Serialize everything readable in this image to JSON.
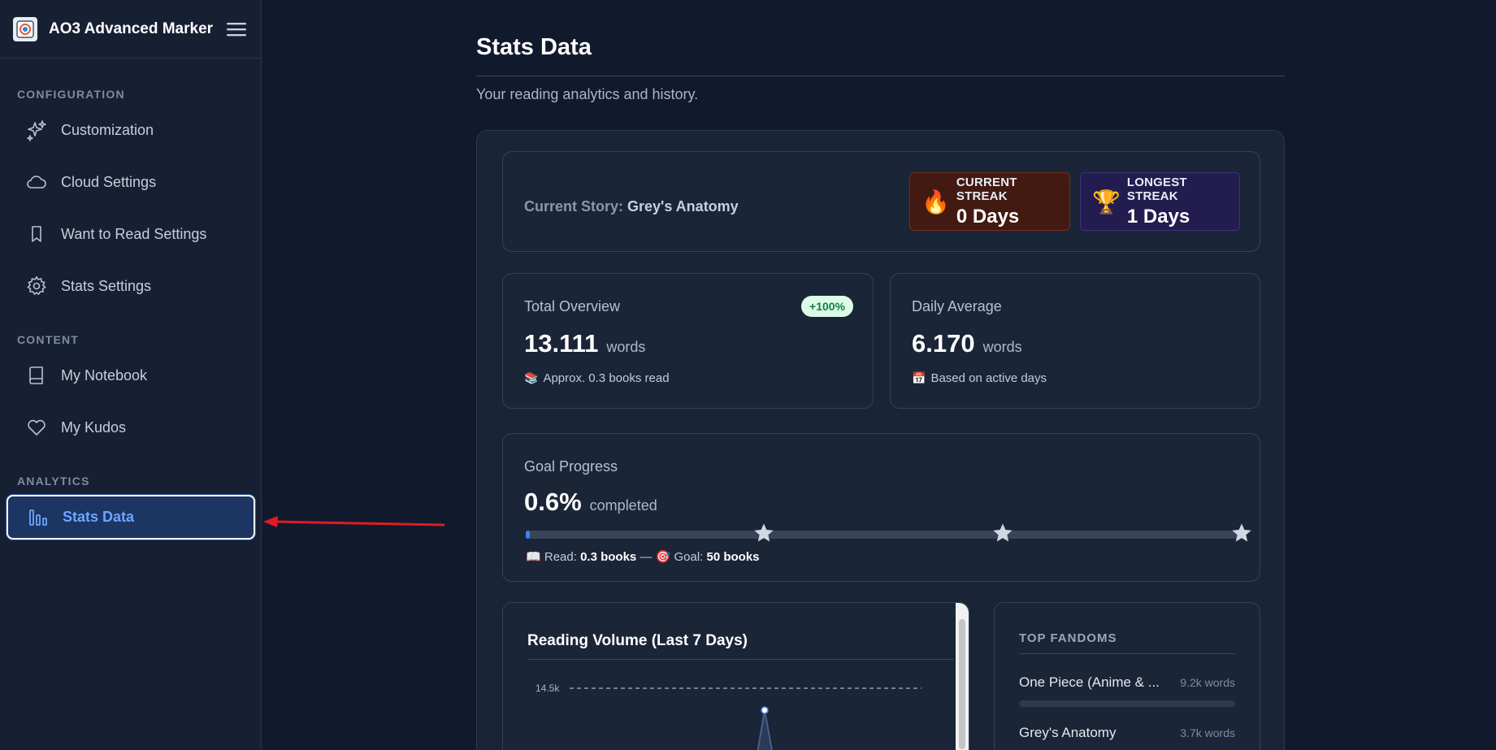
{
  "app": {
    "title": "AO3 Advanced Marker"
  },
  "sidebar": {
    "sections": [
      {
        "title": "CONFIGURATION",
        "items": [
          {
            "label": "Customization",
            "icon": "sparkles-icon"
          },
          {
            "label": "Cloud Settings",
            "icon": "cloud-icon"
          },
          {
            "label": "Want to Read Settings",
            "icon": "bookmark-icon"
          },
          {
            "label": "Stats Settings",
            "icon": "gear-icon"
          }
        ]
      },
      {
        "title": "CONTENT",
        "items": [
          {
            "label": "My Notebook",
            "icon": "notebook-icon"
          },
          {
            "label": "My Kudos",
            "icon": "heart-icon"
          }
        ]
      },
      {
        "title": "ANALYTICS",
        "items": [
          {
            "label": "Stats Data",
            "icon": "bar-chart-icon",
            "active": true
          }
        ]
      }
    ]
  },
  "main": {
    "title": "Stats Data",
    "subtitle": "Your reading analytics and history.",
    "story": {
      "label": "Current Story:",
      "value": "Grey's Anatomy"
    },
    "current_streak": {
      "label": "CURRENT STREAK",
      "value": "0 Days",
      "icon": "flame-icon"
    },
    "longest_streak": {
      "label": "LONGEST STREAK",
      "value": "1 Days",
      "icon": "trophy-icon"
    },
    "total_overview": {
      "label": "Total Overview",
      "badge": "+100%",
      "value": "13.111",
      "unit": "words",
      "note": "Approx. 0.3 books read"
    },
    "daily_average": {
      "label": "Daily Average",
      "value": "6.170",
      "unit": "words",
      "note": "Based on active days"
    },
    "goal": {
      "label": "Goal Progress",
      "value": "0.6%",
      "unit": "completed",
      "progress_fraction": 0.006,
      "read_label": "Read:",
      "read_value": "0.3 books",
      "separator": "—",
      "goal_label": "Goal:",
      "goal_value": "50 books"
    },
    "reading_volume": {
      "title": "Reading Volume (Last 7 Days)"
    },
    "top_fandoms": {
      "title": "TOP FANDOMS",
      "items": [
        {
          "name": "One Piece (Anime & ...",
          "words": "9.2k words",
          "fraction": 0.0
        },
        {
          "name": "Grey's Anatomy",
          "words": "3.7k words",
          "fraction": 0.4
        }
      ]
    }
  },
  "chart_data": {
    "type": "line",
    "title": "Reading Volume (Last 7 Days)",
    "y_ticks_visible": [
      "14.5k"
    ],
    "ylim": [
      0,
      14.5
    ],
    "grid": true
  },
  "colors": {
    "accent": "#3b82f6",
    "badge_bg": "#dcfce7",
    "badge_text": "#15803d",
    "current_streak_bg": "#421a12",
    "longest_streak_bg": "#231c4f"
  }
}
